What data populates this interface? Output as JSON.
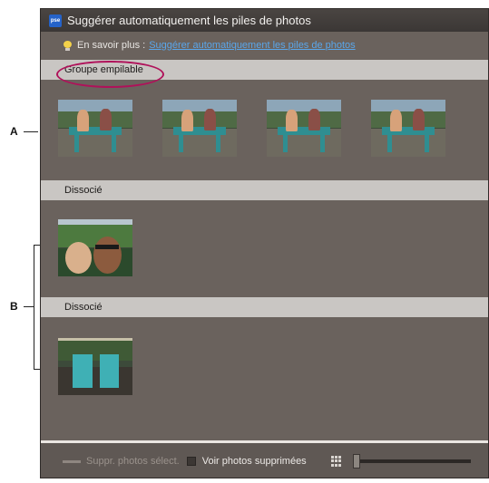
{
  "window": {
    "title": "Suggérer automatiquement les piles de photos",
    "app_icon": "pse",
    "learn_more_label": "En savoir plus :",
    "learn_more_link": "Suggérer automatiquement les piles de photos"
  },
  "groups": [
    {
      "label": "Groupe empilable",
      "photo_count": 4
    },
    {
      "label": "Dissocié",
      "photo_count": 1
    },
    {
      "label": "Dissocié",
      "photo_count": 1
    }
  ],
  "bottom_bar": {
    "delete_label": "Suppr. photos sélect.",
    "show_deleted_label": "Voir photos supprimées"
  },
  "callouts": {
    "a": "A",
    "b": "B"
  },
  "colors": {
    "window_bg": "#6a625d",
    "header_bg": "#c9c6c3",
    "link": "#5aa6ea",
    "highlight_oval": "#b0115a"
  }
}
